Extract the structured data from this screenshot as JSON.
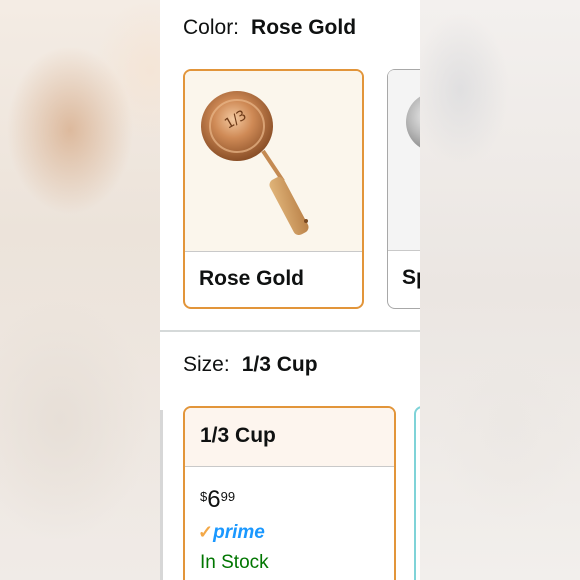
{
  "color_selector": {
    "label": "Color:",
    "selected_value": "Rose Gold",
    "options": [
      {
        "name": "Rose Gold",
        "selected": true,
        "image_icon": "rose-gold-measuring-cup"
      },
      {
        "name": "Sp",
        "selected": false,
        "image_icon": "silver-measuring-cup"
      }
    ]
  },
  "size_selector": {
    "label": "Size:",
    "selected_value": "1/3 Cup",
    "options": [
      {
        "name": "1/3 Cup",
        "selected": true,
        "price": {
          "symbol": "$",
          "whole": "6",
          "fraction": "99"
        },
        "prime": {
          "check": "✓",
          "word": "prime"
        },
        "availability": "In Stock"
      }
    ]
  },
  "colors": {
    "selected_border": "#e2953a",
    "prime_blue": "#1a98ff",
    "prime_check": "#f3a847",
    "in_stock_green": "#007600"
  }
}
